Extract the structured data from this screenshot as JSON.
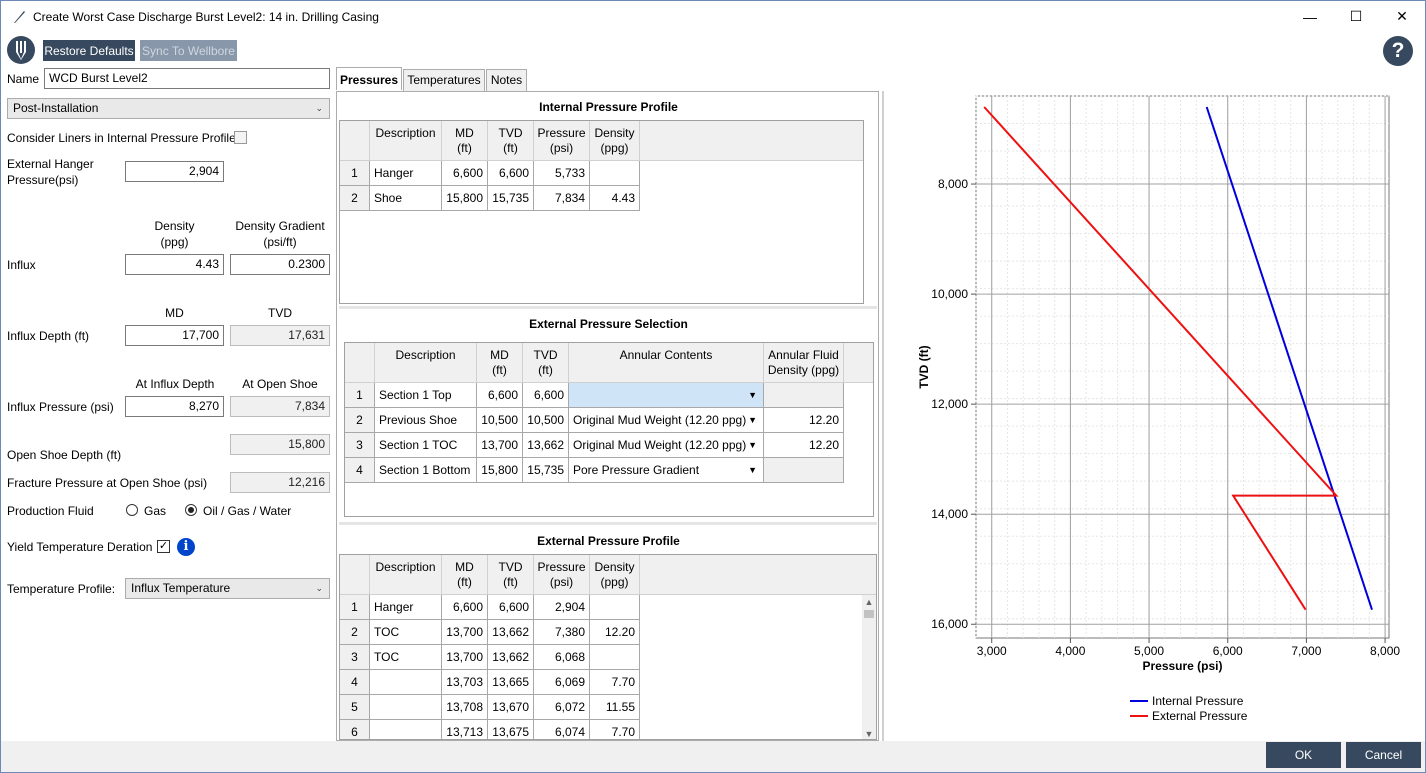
{
  "window": {
    "title": "Create Worst Case Discharge Burst Level2: 14 in. Drilling Casing"
  },
  "toolbar": {
    "restore": "Restore Defaults",
    "sync": "Sync To Wellbore"
  },
  "form": {
    "name_label": "Name",
    "name_value": "WCD Burst Level2",
    "phase": "Post-Installation",
    "liners_label": "Consider Liners in Internal Pressure Profile",
    "hanger_label_1": "External Hanger",
    "hanger_label_2": "Pressure(psi)",
    "hanger_value": "2,904",
    "density_hdr_1": "Density",
    "density_hdr_2": "(ppg)",
    "gradient_hdr_1": "Density Gradient",
    "gradient_hdr_2": "(psi/ft)",
    "influx_label": "Influx",
    "influx_density": "4.43",
    "influx_gradient": "0.2300",
    "md_hdr": "MD",
    "tvd_hdr": "TVD",
    "influx_depth_label": "Influx Depth (ft)",
    "influx_depth_md": "17,700",
    "influx_depth_tvd": "17,631",
    "at_influx_hdr": "At Influx Depth",
    "at_shoe_hdr": "At Open Shoe",
    "influx_pressure_label": "Influx Pressure (psi)",
    "influx_pressure_value": "8,270",
    "influx_pressure_shoe": "7,834",
    "shoe_depth_value": "15,800",
    "open_shoe_label": "Open Shoe Depth (ft)",
    "fracture_label": "Fracture Pressure at Open Shoe (psi)",
    "fracture_value": "12,216",
    "prod_fluid_label": "Production Fluid",
    "gas_label": "Gas",
    "oil_label": "Oil / Gas / Water",
    "yield_label": "Yield Temperature Deration",
    "temp_profile_label": "Temperature Profile:",
    "temp_profile_value": "Influx Temperature"
  },
  "tabs": [
    "Pressures",
    "Temperatures",
    "Notes"
  ],
  "internal": {
    "title": "Internal Pressure Profile",
    "headers": [
      "Description",
      "MD\n(ft)",
      "TVD\n(ft)",
      "Pressure\n(psi)",
      "Density\n(ppg)"
    ],
    "rows": [
      [
        "1",
        "Hanger",
        "6,600",
        "6,600",
        "5,733",
        ""
      ],
      [
        "2",
        "Shoe",
        "15,800",
        "15,735",
        "7,834",
        "4.43"
      ]
    ]
  },
  "external_sel": {
    "title": "External Pressure Selection",
    "headers": [
      "Description",
      "MD\n(ft)",
      "TVD\n(ft)",
      "Annular Contents",
      "Annular Fluid\nDensity (ppg)"
    ],
    "rows": [
      [
        "1",
        "Section 1 Top",
        "6,600",
        "6,600",
        "",
        ""
      ],
      [
        "2",
        "Previous Shoe",
        "10,500",
        "10,500",
        "Original Mud Weight (12.20 ppg)",
        "12.20"
      ],
      [
        "3",
        "Section 1 TOC",
        "13,700",
        "13,662",
        "Original Mud Weight (12.20 ppg)",
        "12.20"
      ],
      [
        "4",
        "Section 1 Bottom",
        "15,800",
        "15,735",
        "Pore Pressure Gradient",
        ""
      ]
    ]
  },
  "external": {
    "title": "External Pressure Profile",
    "headers": [
      "Description",
      "MD\n(ft)",
      "TVD\n(ft)",
      "Pressure\n(psi)",
      "Density\n(ppg)"
    ],
    "rows": [
      [
        "1",
        "Hanger",
        "6,600",
        "6,600",
        "2,904",
        ""
      ],
      [
        "2",
        "TOC",
        "13,700",
        "13,662",
        "7,380",
        "12.20"
      ],
      [
        "3",
        "TOC",
        "13,700",
        "13,662",
        "6,068",
        ""
      ],
      [
        "4",
        "",
        "13,703",
        "13,665",
        "6,069",
        "7.70"
      ],
      [
        "5",
        "",
        "13,708",
        "13,670",
        "6,072",
        "11.55"
      ],
      [
        "6",
        "",
        "13,713",
        "13,675",
        "6,074",
        "7.70"
      ]
    ]
  },
  "chart_data": {
    "type": "line",
    "xlabel": "Pressure (psi)",
    "ylabel": "TVD (ft)",
    "xlim": [
      2800,
      8050
    ],
    "ylim": [
      6400,
      16250
    ],
    "y_inverted": true,
    "xticks": [
      3000,
      4000,
      5000,
      6000,
      7000,
      8000
    ],
    "xtick_labels": [
      "3,000",
      "4,000",
      "5,000",
      "6,000",
      "7,000",
      "8,000"
    ],
    "yticks": [
      8000,
      10000,
      12000,
      14000,
      16000
    ],
    "ytick_labels": [
      "8,000",
      "10,000",
      "12,000",
      "14,000",
      "16,000"
    ],
    "grid": true,
    "legend": "bottom",
    "series": [
      {
        "name": "Internal Pressure",
        "color": "#0000dd",
        "points": [
          [
            5733,
            6600
          ],
          [
            7834,
            15735
          ]
        ]
      },
      {
        "name": "External Pressure",
        "color": "#ee1111",
        "points": [
          [
            2904,
            6600
          ],
          [
            7380,
            13662
          ],
          [
            6068,
            13662
          ],
          [
            6069,
            13665
          ],
          [
            6072,
            13670
          ],
          [
            6074,
            13675
          ],
          [
            6990,
            15735
          ]
        ]
      }
    ]
  },
  "buttons": {
    "ok": "OK",
    "cancel": "Cancel"
  }
}
